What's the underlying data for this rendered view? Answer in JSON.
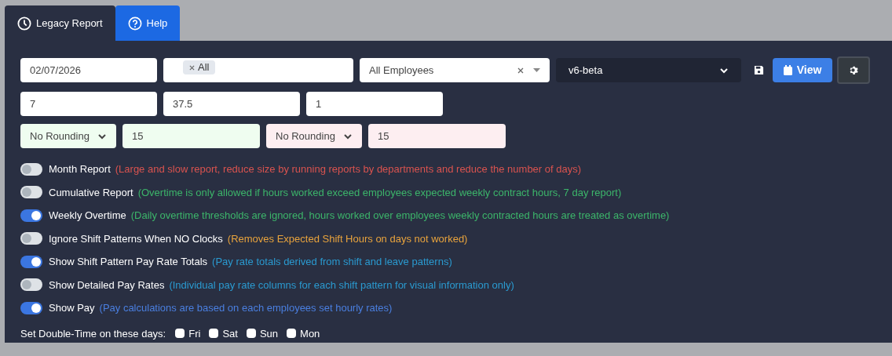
{
  "tabs": [
    {
      "label": "Legacy Report",
      "kind": "clock",
      "selected": true
    },
    {
      "label": "Help",
      "kind": "help",
      "selected": false
    }
  ],
  "row1": {
    "date": "02/07/2026",
    "tags": [
      "All"
    ],
    "employees": "All Employees",
    "version": "v6-beta",
    "view_button": "View"
  },
  "row2": [
    "7",
    "37.5",
    "1"
  ],
  "rounding": [
    {
      "select": "No Rounding",
      "value": "15",
      "color": "#effdf0"
    },
    {
      "select": "No Rounding",
      "value": "15",
      "color": "#fdeef1"
    }
  ],
  "options": [
    {
      "label": "Month Report",
      "note": "(Large and slow report, reduce size by running reports by departments and reduce the number of days)",
      "color": "#d9534f",
      "on": false
    },
    {
      "label": "Cumulative Report",
      "note": "(Overtime is only allowed if hours worked exceed employees expected weekly contract hours, 7 day report)",
      "color": "#3cb56a",
      "on": false
    },
    {
      "label": "Weekly Overtime",
      "note": "(Daily overtime thresholds are ignored, hours worked over employees weekly contracted hours are treated as overtime)",
      "color": "#3cb56a",
      "on": true
    },
    {
      "label": "Ignore Shift Patterns When NO Clocks",
      "note": "(Removes Expected Shift Hours on days not worked)",
      "color": "#e8a33d",
      "on": false
    },
    {
      "label": "Show Shift Pattern Pay Rate Totals",
      "note": "(Pay rate totals derived from shift and leave patterns)",
      "color": "#2a9ad0",
      "on": true
    },
    {
      "label": "Show Detailed Pay Rates",
      "note": "(Individual pay rate columns for each shift pattern for visual information only)",
      "color": "#2a9ad0",
      "on": false
    },
    {
      "label": "Show Pay",
      "note": "(Pay calculations are based on each employees set hourly rates)",
      "color": "#4a7fe0",
      "on": true
    }
  ],
  "double_time": {
    "label": "Set Double-Time on these days:",
    "days": [
      {
        "label": "Fri",
        "checked": false
      },
      {
        "label": "Sat",
        "checked": false
      },
      {
        "label": "Sun",
        "checked": false
      },
      {
        "label": "Mon",
        "checked": false
      }
    ]
  }
}
